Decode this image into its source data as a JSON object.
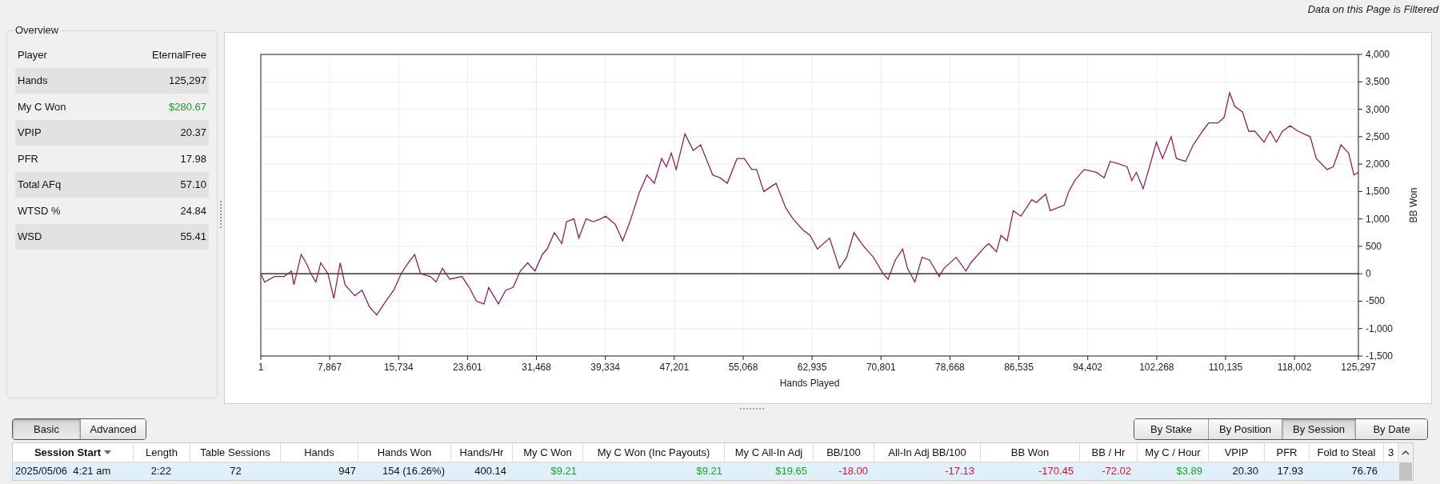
{
  "filter_notice": "Data on this Page is Filtered",
  "overview": {
    "title": "Overview",
    "rows": [
      {
        "label": "Player",
        "value": "EternalFree",
        "color": "#111111"
      },
      {
        "label": "Hands",
        "value": "125,297",
        "color": "#111111"
      },
      {
        "label": "My C Won",
        "value": "$280.67",
        "color": "#1f9e2a"
      },
      {
        "label": "VPIP",
        "value": "20.37",
        "color": "#111111"
      },
      {
        "label": "PFR",
        "value": "17.98",
        "color": "#111111"
      },
      {
        "label": "Total AFq",
        "value": "57.10",
        "color": "#111111"
      },
      {
        "label": "WTSD %",
        "value": "24.84",
        "color": "#111111"
      },
      {
        "label": "WSD",
        "value": "55.41",
        "color": "#111111"
      }
    ]
  },
  "chart": {
    "chart_data": {
      "type": "line",
      "grid": true,
      "xlabel": "Hands Played",
      "ylabel": "BB Won",
      "xlim": [
        1,
        125297
      ],
      "ylim": [
        -1500,
        4000
      ],
      "xticks": [
        {
          "value": 1,
          "label": "1"
        },
        {
          "value": 7867,
          "label": "7,867"
        },
        {
          "value": 15734,
          "label": "15,734"
        },
        {
          "value": 23601,
          "label": "23,601"
        },
        {
          "value": 31468,
          "label": "31,468"
        },
        {
          "value": 39334,
          "label": "39,334"
        },
        {
          "value": 47201,
          "label": "47,201"
        },
        {
          "value": 55068,
          "label": "55,068"
        },
        {
          "value": 62935,
          "label": "62,935"
        },
        {
          "value": 70801,
          "label": "70,801"
        },
        {
          "value": 78668,
          "label": "78,668"
        },
        {
          "value": 86535,
          "label": "86,535"
        },
        {
          "value": 94402,
          "label": "94,402"
        },
        {
          "value": 102268,
          "label": "102,268"
        },
        {
          "value": 110135,
          "label": "110,135"
        },
        {
          "value": 118002,
          "label": "118,002"
        },
        {
          "value": 125297,
          "label": "125,297"
        }
      ],
      "yticks": [
        {
          "value": 4000,
          "label": "4,000"
        },
        {
          "value": 3500,
          "label": "3,500"
        },
        {
          "value": 3000,
          "label": "3,000"
        },
        {
          "value": 2500,
          "label": "2,500"
        },
        {
          "value": 2000,
          "label": "2,000"
        },
        {
          "value": 1500,
          "label": "1,500"
        },
        {
          "value": 1000,
          "label": "1,000"
        },
        {
          "value": 500,
          "label": "500"
        },
        {
          "value": 0,
          "label": "0"
        },
        {
          "value": -500,
          "label": "-500"
        },
        {
          "value": -1000,
          "label": "-1,000"
        },
        {
          "value": -1500,
          "label": "-1,500"
        }
      ],
      "x": [
        1,
        445,
        1557,
        2668,
        3502,
        3780,
        4614,
        5170,
        5726,
        6282,
        6838,
        7671,
        8339,
        9061,
        9617,
        10729,
        11563,
        12397,
        13230,
        14064,
        15176,
        16010,
        16844,
        17566,
        18234,
        19345,
        20012,
        20735,
        21569,
        22958,
        23793,
        24626,
        25460,
        26016,
        27128,
        27962,
        28796,
        29630,
        30463,
        31297,
        32131,
        32687,
        33521,
        34355,
        34911,
        35744,
        36300,
        37134,
        37968,
        38802,
        39358,
        40470,
        41303,
        42137,
        43249,
        44083,
        44917,
        45751,
        46306,
        46862,
        47418,
        48419,
        49364,
        50198,
        51588,
        52421,
        53255,
        54367,
        55201,
        56035,
        56591,
        57425,
        58815,
        59927,
        60760,
        61872,
        62706,
        63540,
        64930,
        66042,
        66876,
        67710,
        68822,
        69933,
        71045,
        71601,
        72435,
        73269,
        73825,
        74659,
        75493,
        76326,
        77438,
        77994,
        79384,
        80496,
        81052,
        82720,
        83093,
        83971,
        84498,
        85200,
        85903,
        86781,
        88010,
        88537,
        89591,
        90117,
        91698,
        92225,
        92927,
        93981,
        95386,
        96263,
        96966,
        98019,
        98897,
        99424,
        99951,
        100724,
        101531,
        102234,
        102936,
        103919,
        104517,
        105570,
        106448,
        107502,
        108204,
        109258,
        109960,
        110592,
        111189,
        112067,
        112770,
        113472,
        114526,
        115228,
        115931,
        116633,
        117511,
        118389,
        119794,
        120497,
        121726,
        122429,
        123307,
        124185,
        124782,
        125297
      ],
      "series": [
        {
          "color": "#8e2456",
          "values": [
            0,
            -150,
            -50,
            -50,
            50,
            -200,
            350,
            200,
            0,
            -150,
            200,
            0,
            -450,
            200,
            -200,
            -400,
            -300,
            -600,
            -750,
            -550,
            -300,
            0,
            200,
            350,
            0,
            -50,
            -150,
            100,
            -100,
            -50,
            -250,
            -500,
            -550,
            -250,
            -550,
            -300,
            -250,
            50,
            200,
            50,
            350,
            450,
            750,
            550,
            950,
            1000,
            650,
            1000,
            950,
            1000,
            1050,
            900,
            600,
            950,
            1500,
            1800,
            1650,
            2100,
            1950,
            2200,
            1900,
            2550,
            2250,
            2350,
            1800,
            1750,
            1650,
            2100,
            2100,
            1900,
            1900,
            1500,
            1650,
            1200,
            1000,
            800,
            700,
            450,
            650,
            100,
            300,
            750,
            500,
            300,
            0,
            -100,
            250,
            450,
            100,
            -150,
            300,
            250,
            -50,
            100,
            300,
            50,
            200,
            500,
            550,
            400,
            700,
            600,
            1150,
            1050,
            1350,
            1300,
            1450,
            1150,
            1250,
            1500,
            1700,
            1900,
            1850,
            1750,
            2050,
            2000,
            1950,
            1700,
            1850,
            1550,
            2000,
            2400,
            2100,
            2500,
            2100,
            2050,
            2350,
            2600,
            2750,
            2750,
            2850,
            3300,
            3050,
            2950,
            2600,
            2600,
            2400,
            2600,
            2400,
            2600,
            2700,
            2600,
            2500,
            2100,
            1900,
            1950,
            2350,
            2200,
            1800,
            1850
          ]
        }
      ]
    }
  },
  "view_toggle": [
    {
      "label": "Basic",
      "selected": true
    },
    {
      "label": "Advanced",
      "selected": false
    }
  ],
  "group_toggle": [
    {
      "label": "By Stake",
      "selected": false
    },
    {
      "label": "By Position",
      "selected": false
    },
    {
      "label": "By Session",
      "selected": true
    },
    {
      "label": "By Date",
      "selected": false
    }
  ],
  "table": {
    "columns": [
      {
        "label": "Session Start",
        "sorted": true
      },
      {
        "label": "Length",
        "sorted": false
      },
      {
        "label": "Table Sessions",
        "sorted": false
      },
      {
        "label": "Hands",
        "sorted": false
      },
      {
        "label": "Hands Won",
        "sorted": false
      },
      {
        "label": "Hands/Hr",
        "sorted": false
      },
      {
        "label": "My C Won",
        "sorted": false
      },
      {
        "label": "My C Won (Inc Payouts)",
        "sorted": false
      },
      {
        "label": "My C All-In Adj",
        "sorted": false
      },
      {
        "label": "BB/100",
        "sorted": false
      },
      {
        "label": "All-In Adj BB/100",
        "sorted": false
      },
      {
        "label": "BB Won",
        "sorted": false
      },
      {
        "label": "BB / Hr",
        "sorted": false
      },
      {
        "label": "My C / Hour",
        "sorted": false
      },
      {
        "label": "VPIP",
        "sorted": false
      },
      {
        "label": "PFR",
        "sorted": false
      },
      {
        "label": "Fold to Steal",
        "sorted": false
      },
      {
        "label": "3",
        "sorted": false
      }
    ],
    "rows": [
      {
        "selected": true,
        "cells": [
          {
            "text": "2025/05/06  4:21 am",
            "color": "#111111"
          },
          {
            "text": "2:22",
            "color": "#111111"
          },
          {
            "text": "72",
            "color": "#111111"
          },
          {
            "text": "947",
            "color": "#111111"
          },
          {
            "text": "154 (16.26%)",
            "color": "#111111"
          },
          {
            "text": "400.14",
            "color": "#111111"
          },
          {
            "text": "$9.21",
            "color": "#1f9e2a"
          },
          {
            "text": "$9.21",
            "color": "#1f9e2a"
          },
          {
            "text": "$19.65",
            "color": "#1f9e2a"
          },
          {
            "text": "-18.00",
            "color": "#c41e3a"
          },
          {
            "text": "-17.13",
            "color": "#c41e3a"
          },
          {
            "text": "-170.45",
            "color": "#c41e3a"
          },
          {
            "text": "-72.02",
            "color": "#c41e3a"
          },
          {
            "text": "$3.89",
            "color": "#1f9e2a"
          },
          {
            "text": "20.30",
            "color": "#111111"
          },
          {
            "text": "17.93",
            "color": "#111111"
          },
          {
            "text": "76.76",
            "color": "#111111"
          }
        ]
      }
    ]
  }
}
